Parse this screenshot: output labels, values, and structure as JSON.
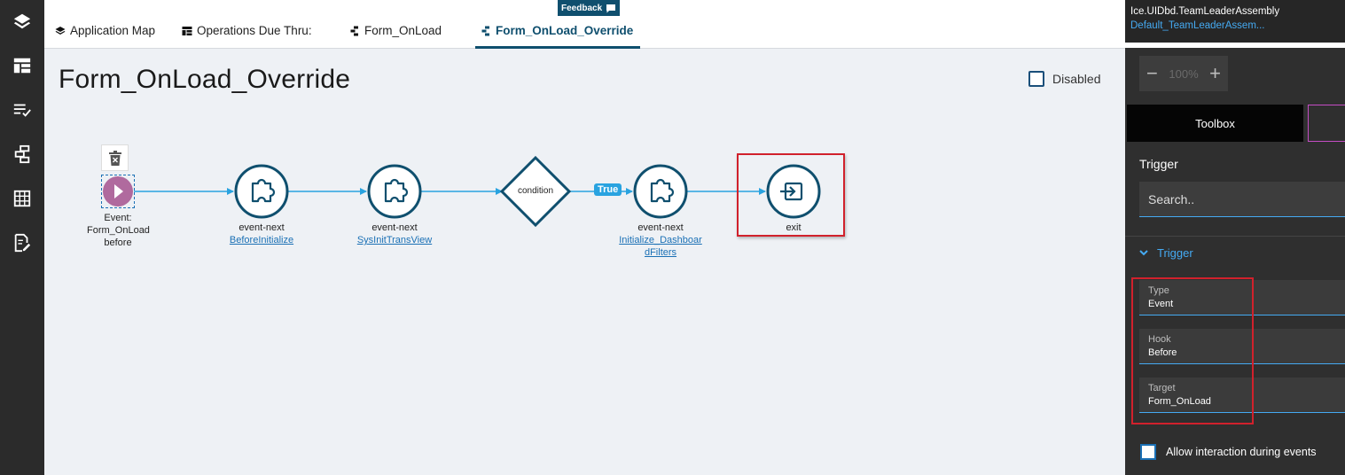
{
  "rail": {
    "icons": [
      "layers-icon",
      "table-layout-icon",
      "checklist-icon",
      "workflow-icon",
      "grid-icon",
      "edit-doc-icon"
    ]
  },
  "tabs": [
    {
      "label": "Application Map",
      "icon": "layers-icon"
    },
    {
      "label": "Operations Due Thru:",
      "icon": "table-icon"
    },
    {
      "label": "Form_OnLoad",
      "icon": "workflow-icon"
    },
    {
      "label": "Form_OnLoad_Override",
      "icon": "workflow-icon",
      "active": true
    }
  ],
  "feedback": {
    "label": "Feedback",
    "icon": "comment-icon"
  },
  "canvas": {
    "title": "Form_OnLoad_Override",
    "disabled_label": "Disabled",
    "disabled_checked": false
  },
  "flow": {
    "start": {
      "line1": "Event:",
      "line2": "Form_OnLoad",
      "line3": "before"
    },
    "nodes": [
      {
        "type": "event-next",
        "link": "BeforeInitialize"
      },
      {
        "type": "event-next",
        "link": "SysInitTransView"
      },
      {
        "type": "condition"
      },
      {
        "type": "event-next",
        "link_line1": "Initialize_Dashboar",
        "link_line2": "dFilters"
      },
      {
        "type": "exit"
      }
    ],
    "condition_label": "condition",
    "true_label": "True",
    "exit_label": "exit",
    "colors": {
      "node": "#0f4f6e",
      "edge": "#29a3e0",
      "start": "#b06a9e",
      "highlight": "#d1212c"
    }
  },
  "panel": {
    "assembly": "Ice.UIDbd.TeamLeaderAssembly",
    "assembly_link": "Default_TeamLeaderAssem...",
    "zoom": {
      "minus": "−",
      "value": "100%",
      "plus": "+"
    },
    "tab_toolbox": "Toolbox",
    "section_title": "Trigger",
    "search_placeholder": "Search..",
    "accordion_label": "Trigger",
    "props": [
      {
        "label": "Type",
        "value": "Event"
      },
      {
        "label": "Hook",
        "value": "Before"
      },
      {
        "label": "Target",
        "value": "Form_OnLoad"
      }
    ],
    "allow_label": "Allow interaction during events",
    "allow_checked": false
  }
}
